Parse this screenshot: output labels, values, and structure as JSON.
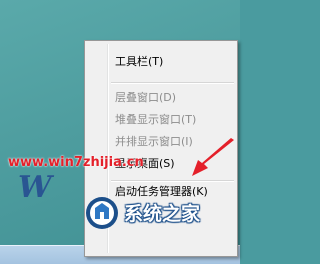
{
  "context_menu": {
    "items": [
      {
        "label": "工具栏(T)",
        "enabled": true,
        "has_submenu": true
      },
      {
        "label": "层叠窗口(D)",
        "enabled": false
      },
      {
        "label": "堆叠显示窗口(T)",
        "enabled": false
      },
      {
        "label": "并排显示窗口(I)",
        "enabled": false
      },
      {
        "label": "显示桌面(S)",
        "enabled": true
      },
      {
        "label": "启动任务管理器(K)",
        "enabled": true,
        "highlighted_by_arrow": true
      }
    ]
  },
  "watermark": {
    "url": "www.win7zhijia.cn",
    "logo_text": "W",
    "brand_text": "系统之家"
  },
  "colors": {
    "desktop": "#4e9d9f",
    "menu_background": "#f0f0f0",
    "arrow": "#e4202a",
    "url_text": "#e4202a"
  }
}
